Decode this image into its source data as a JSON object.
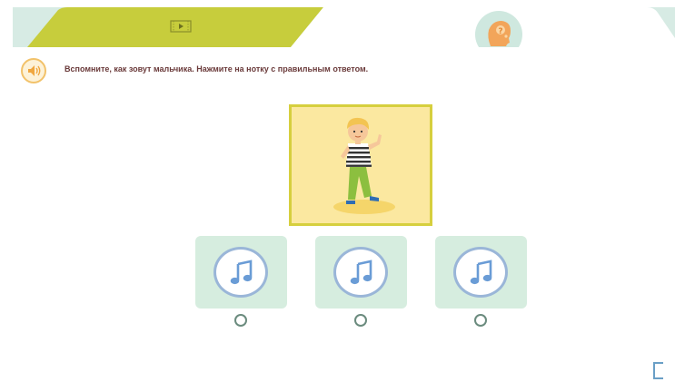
{
  "instruction": {
    "text": "Вспомните, как зовут мальчика. Нажмите на нотку с правильным ответом."
  },
  "tabs": [
    {
      "icon": "video-play-icon",
      "active": false
    },
    {
      "icon": "thinking-head-icon",
      "active": true
    }
  ],
  "answers": [
    {
      "icon": "music-note-icon",
      "selected": false
    },
    {
      "icon": "music-note-icon",
      "selected": false
    },
    {
      "icon": "music-note-icon",
      "selected": false
    }
  ],
  "colors": {
    "tab_inactive": "#c7cd3c",
    "tab_active_bg": "#ffffff",
    "frame_bg": "#fbe8a0",
    "frame_border": "#d6cf3e",
    "answer_bg": "#d6eddf",
    "note_color": "#6a9cd6",
    "instruction_text": "#6a3a3a"
  }
}
